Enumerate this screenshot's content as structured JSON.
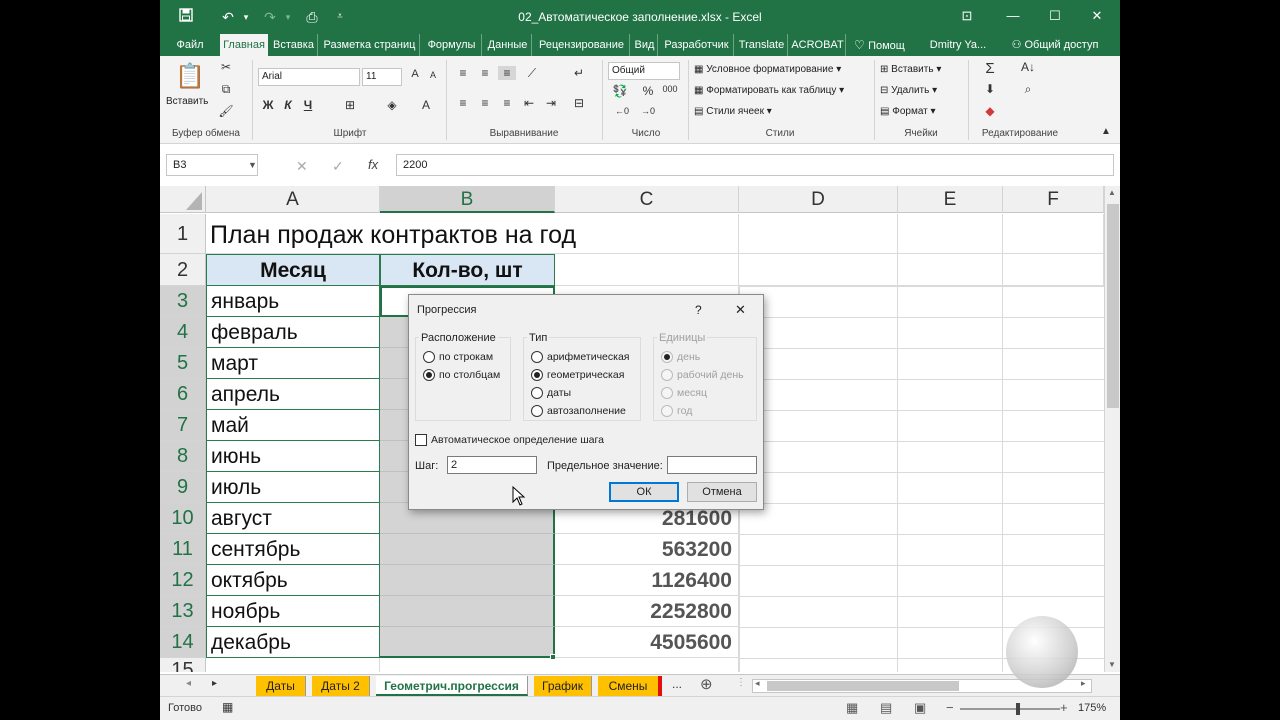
{
  "window": {
    "title": "02_Автоматическое заполнение.xlsx - Excel",
    "minimize": "—",
    "restore": "☐",
    "close": "✕",
    "ribbon_display": "⊡"
  },
  "tabs": [
    {
      "label": "Файл"
    },
    {
      "label": "Главная"
    },
    {
      "label": "Вставка"
    },
    {
      "label": "Разметка страниц"
    },
    {
      "label": "Формулы"
    },
    {
      "label": "Данные"
    },
    {
      "label": "Рецензирование"
    },
    {
      "label": "Вид"
    },
    {
      "label": "Разработчик"
    },
    {
      "label": "Translate"
    },
    {
      "label": "ACROBAT"
    },
    {
      "label": "Помощ"
    },
    {
      "label": "Dmitry Ya..."
    },
    {
      "label": "Общий доступ"
    }
  ],
  "ribbon": {
    "paste_label": "Вставить",
    "font_name": "Arial",
    "font_size": "11",
    "bold": "Ж",
    "italic": "К",
    "underline": "Ч",
    "number_format": "Общий",
    "conditional": "Условное форматирование",
    "format_table": "Форматировать как таблицу",
    "cell_styles": "Стили ячеек",
    "insert": "Вставить",
    "delete": "Удалить",
    "format": "Формат",
    "groups": {
      "clipboard": "Буфер обмена",
      "font": "Шрифт",
      "alignment": "Выравнивание",
      "number": "Число",
      "styles": "Стили",
      "cells": "Ячейки",
      "editing": "Редактирование"
    }
  },
  "formula_bar": {
    "name_box": "B3",
    "value": "2200",
    "fx": "fx"
  },
  "columns": [
    "A",
    "B",
    "C",
    "D",
    "E",
    "F"
  ],
  "rows": [
    "1",
    "2",
    "3",
    "4",
    "5",
    "6",
    "7",
    "8",
    "9",
    "10",
    "11",
    "12",
    "13",
    "14",
    "15"
  ],
  "sheet": {
    "title": "План продаж контрактов на год",
    "header_month": "Месяц",
    "header_qty": "Кол-во, шт",
    "months": [
      "январь",
      "февраль",
      "март",
      "апрель",
      "май",
      "июнь",
      "июль",
      "август",
      "сентябрь",
      "октябрь",
      "ноябрь",
      "декабрь"
    ],
    "c_values": [
      "281600",
      "563200",
      "1126400",
      "2252800",
      "4505600"
    ],
    "b3_partial": "2200"
  },
  "dialog": {
    "title": "Прогрессия",
    "help": "?",
    "close": "✕",
    "location_label": "Расположение",
    "by_rows": "по строкам",
    "by_cols": "по столбцам",
    "type_label": "Тип",
    "arith": "арифметическая",
    "geom": "геометрическая",
    "dates": "даты",
    "autofill": "автозаполнение",
    "units_label": "Единицы",
    "day": "день",
    "workday": "рабочий день",
    "month": "месяц",
    "year": "год",
    "auto_step": "Автоматическое определение шага",
    "step_label": "Шаг:",
    "step_value": "2",
    "limit_label": "Предельное значение:",
    "limit_value": "",
    "ok": "ОК",
    "cancel": "Отмена"
  },
  "sheet_tabs": [
    "Даты",
    "Даты 2",
    "Геометрич.прогрессия",
    "График",
    "Смены",
    "..."
  ],
  "status": {
    "ready": "Готово",
    "zoom": "175%"
  }
}
